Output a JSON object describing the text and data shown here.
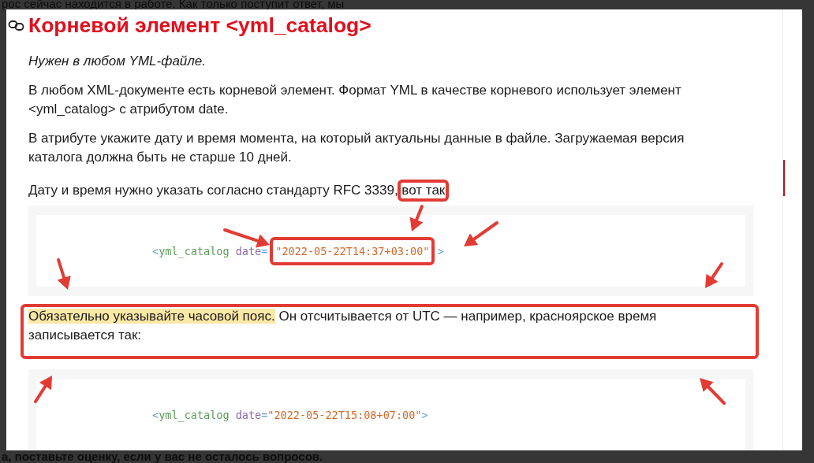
{
  "background_text": {
    "top": "рос сейчас находится в работе. Как только поступит ответ, мы",
    "bottom": "а, поставьте оценку, если у вас не осталось вопросов."
  },
  "article": {
    "title": "Корневой элемент <yml_catalog>",
    "blocks": [
      {
        "kind": "lead",
        "text": "Нужен в любом YML-файле."
      },
      {
        "kind": "paragraph",
        "text": "В любом XML-документе есть корневой элемент. Формат YML в качестве корневого использует элемент <yml_catalog> с атрибутом date."
      },
      {
        "kind": "paragraph",
        "text": "В атрибуте укажите дату и время момента, на который актуальны данные в файле. Загружаемая версия каталога должна быть не старше 10 дней."
      },
      {
        "kind": "paragraph",
        "text": "Дату и время нужно указать согласно стандарту RFC 3339,",
        "link": "вот так",
        "link_framed": true
      },
      {
        "kind": "code",
        "tokens": [
          {
            "kind": "punct",
            "text": "<"
          },
          {
            "kind": "tag",
            "text": "yml_catalog"
          },
          {
            "kind": "attr",
            "text": " date"
          },
          {
            "kind": "punct",
            "text": "="
          },
          {
            "kind": "value",
            "text": "\"2022-05-22T14:37+03:00\"",
            "framed": true
          },
          {
            "kind": "punct",
            "text": ">"
          }
        ]
      },
      {
        "kind": "note",
        "framed": true,
        "highlight": "Обязательно указывайте часовой пояс.",
        "text": " Он отсчитывается от UTC — например, красноярское время записывается так:"
      },
      {
        "kind": "code",
        "tokens": [
          {
            "kind": "punct",
            "text": "<"
          },
          {
            "kind": "tag",
            "text": "yml_catalog"
          },
          {
            "kind": "attr",
            "text": " date"
          },
          {
            "kind": "punct",
            "text": "="
          },
          {
            "kind": "value",
            "text": "\"2022-05-22T15:08+07:00\""
          },
          {
            "kind": "punct",
            "text": ">"
          }
        ]
      }
    ]
  }
}
